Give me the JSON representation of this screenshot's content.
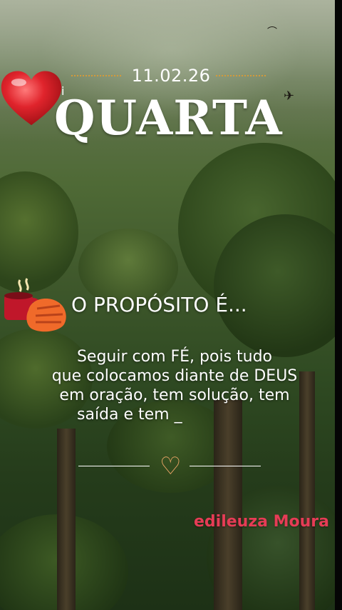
{
  "header": {
    "date": "11.02.26",
    "small_letter": "i",
    "day": "QUARTA"
  },
  "main": {
    "headline": "O PROPÓSITO É...",
    "body_lines": [
      "Seguir com FÉ, pois tudo",
      "que colocamos diante de DEUS",
      "em oração, tem solução, tem",
      "saída e tem _"
    ],
    "divider_heart": "♡"
  },
  "footer": {
    "signature": "edileuza Moura"
  },
  "icons": [
    "heart-icon",
    "coffee-cup-icon",
    "hand-icon",
    "outline-heart-icon"
  ],
  "colors": {
    "accent_orange": "#d49a3a",
    "heart_red": "#e0242c",
    "signature_pink": "#e63c56",
    "outline_heart": "#f3a96a"
  }
}
